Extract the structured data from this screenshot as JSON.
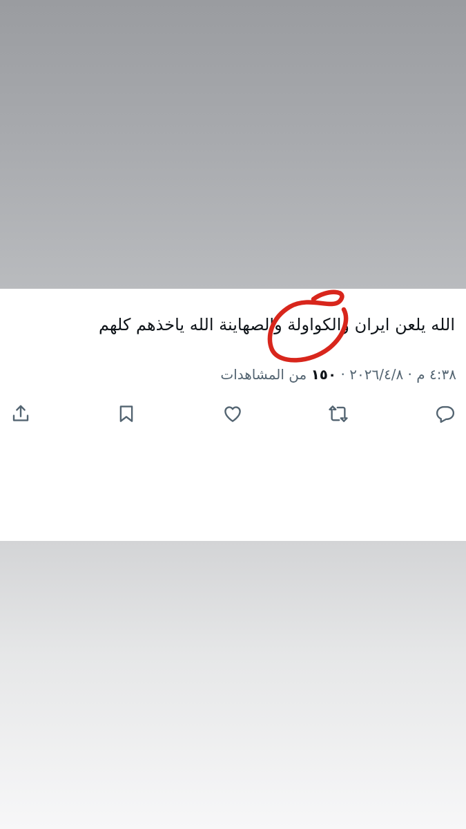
{
  "tweet": {
    "text": "الله يلعن ايران والكواولة والصهاينة الله ياخذهم كلهم",
    "time": "٤:٣٨ م",
    "separator": " · ",
    "date": "٢٠٢٦/٤/٨",
    "views_count": "١٥٠",
    "views_label": " من المشاهدات"
  },
  "actions": [
    {
      "name": "reply",
      "icon": "reply-icon"
    },
    {
      "name": "retweet",
      "icon": "retweet-icon"
    },
    {
      "name": "like",
      "icon": "heart-icon"
    },
    {
      "name": "bookmark",
      "icon": "bookmark-icon"
    },
    {
      "name": "share",
      "icon": "share-icon"
    }
  ],
  "colors": {
    "text": "#0f1419",
    "secondary": "#536471",
    "annotation": "#d8261c"
  }
}
